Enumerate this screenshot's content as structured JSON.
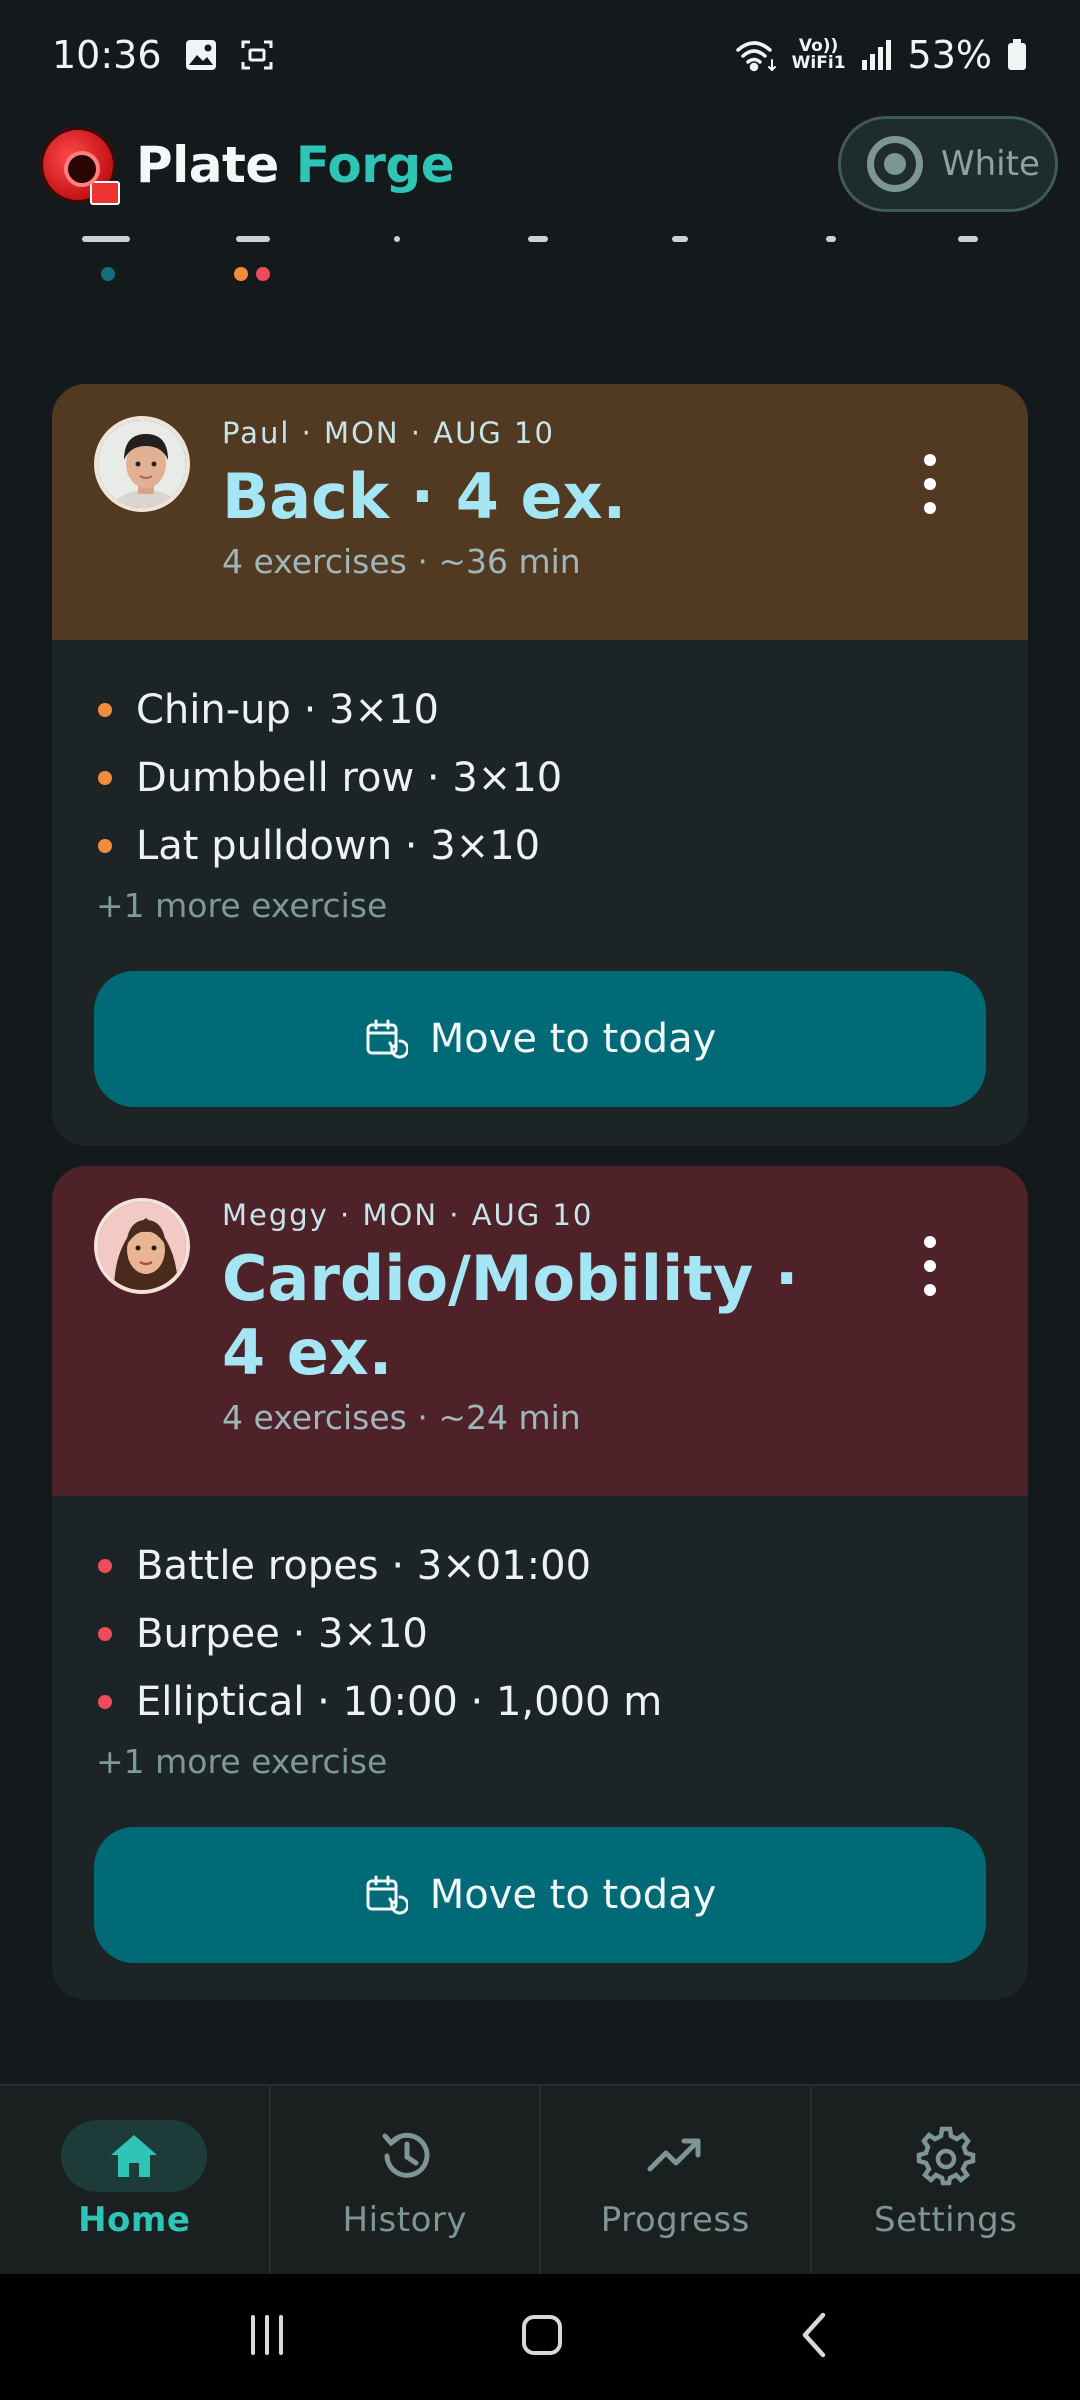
{
  "status_bar": {
    "time": "10:36",
    "volte_top": "Vo))",
    "volte_bottom": "WiFi1",
    "battery": "53%"
  },
  "app": {
    "brand_first": "Plate",
    "brand_second": "Forge",
    "theme_label": "White"
  },
  "cards": [
    {
      "meta": "Paul · MON · AUG 10",
      "title": "Back · 4 ex.",
      "subtitle": "4 exercises · ~36 min",
      "header_color": "#523a22",
      "bullet_color": "#f28b3a",
      "exercises": [
        "Chin-up · 3×10",
        "Dumbbell row · 3×10",
        "Lat pulldown · 3×10"
      ],
      "more": "+1 more exercise",
      "button": "Move to today"
    },
    {
      "meta": "Meggy · MON · AUG 10",
      "title": "Cardio/Mobility · 4 ex.",
      "subtitle": "4 exercises · ~24 min",
      "header_color": "#4f222a",
      "bullet_color": "#ef4a5e",
      "exercises": [
        "Battle ropes · 3×01:00",
        "Burpee · 3×10",
        "Elliptical · 10:00 · 1,000 m"
      ],
      "more": "+1 more exercise",
      "button": "Move to today"
    }
  ],
  "nav": {
    "items": [
      {
        "label": "Home",
        "icon": "home-icon",
        "active": true
      },
      {
        "label": "History",
        "icon": "history-icon",
        "active": false
      },
      {
        "label": "Progress",
        "icon": "trending-up-icon",
        "active": false
      },
      {
        "label": "Settings",
        "icon": "gear-icon",
        "active": false
      }
    ]
  },
  "colors": {
    "accent": "#2ec4b6",
    "button": "#006a77",
    "title": "#a5e6f5"
  }
}
